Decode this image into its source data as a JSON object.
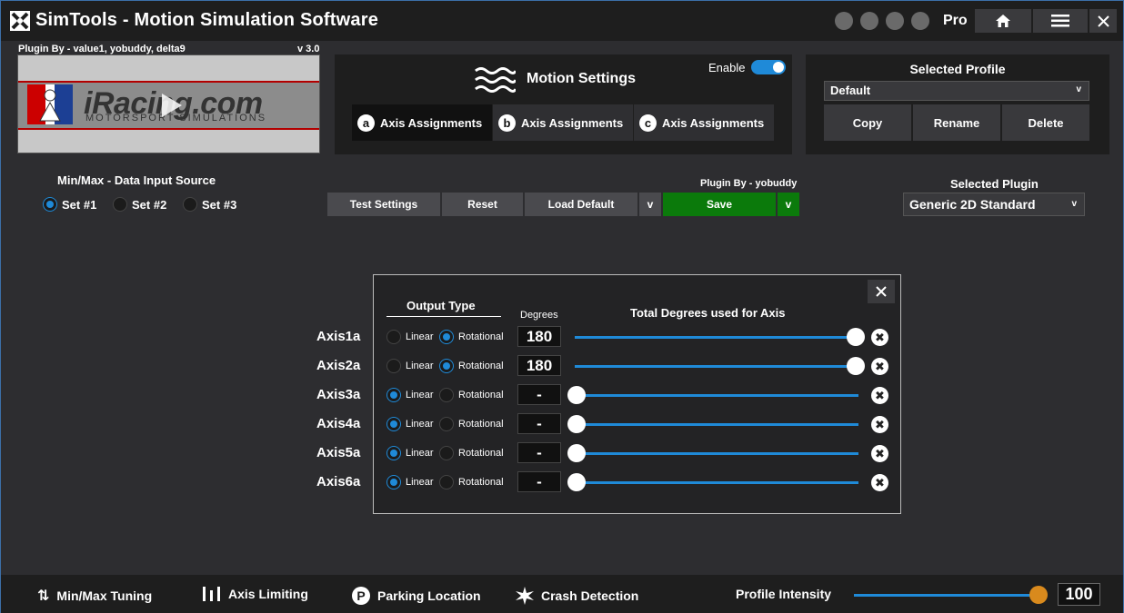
{
  "app": {
    "title": "SimTools - Motion Simulation Software",
    "edition": "Pro",
    "accent": "#1f8ad8"
  },
  "plugin_header": {
    "credit": "Plugin By - value1, yobuddy, delta9",
    "version": "v 3.0",
    "banner_brand": "iRacing.com",
    "banner_tagline": "MOTORSPORT SIMULATIONS"
  },
  "motion_settings": {
    "title": "Motion Settings",
    "enable_label": "Enable",
    "enabled": true,
    "tabs": [
      {
        "badge": "a",
        "label": "Axis Assignments"
      },
      {
        "badge": "b",
        "label": "Axis Assignments"
      },
      {
        "badge": "c",
        "label": "Axis Assignments"
      }
    ]
  },
  "profile": {
    "title": "Selected Profile",
    "selected": "Default",
    "buttons": {
      "copy": "Copy",
      "rename": "Rename",
      "delete": "Delete"
    }
  },
  "minmax": {
    "title": "Min/Max - Data Input Source",
    "sets": [
      {
        "label": "Set #1",
        "selected": true
      },
      {
        "label": "Set #2",
        "selected": false
      },
      {
        "label": "Set #3",
        "selected": false
      }
    ]
  },
  "actions": {
    "plugin_by": "Plugin By - yobuddy",
    "test": "Test Settings",
    "reset": "Reset",
    "load_default": "Load Default",
    "dropdown": "v",
    "save": "Save",
    "save_dropdown": "v",
    "save_color": "#0b7a0b"
  },
  "selected_plugin": {
    "title": "Selected Plugin",
    "value": "Generic 2D Standard"
  },
  "dialog": {
    "output_type": "Output Type",
    "degrees": "Degrees",
    "total": "Total Degrees used for Axis",
    "linear_label": "Linear",
    "rotational_label": "Rotational",
    "max_degrees": 180,
    "rows": [
      {
        "axis": "Axis1a",
        "linear": false,
        "rotational": true,
        "degrees": "180",
        "level": 1.0
      },
      {
        "axis": "Axis2a",
        "linear": false,
        "rotational": true,
        "degrees": "180",
        "level": 1.0
      },
      {
        "axis": "Axis3a",
        "linear": true,
        "rotational": false,
        "degrees": "-",
        "level": 0.0
      },
      {
        "axis": "Axis4a",
        "linear": true,
        "rotational": false,
        "degrees": "-",
        "level": 0.0
      },
      {
        "axis": "Axis5a",
        "linear": true,
        "rotational": false,
        "degrees": "-",
        "level": 0.0
      },
      {
        "axis": "Axis6a",
        "linear": true,
        "rotational": false,
        "degrees": "-",
        "level": 0.0
      }
    ]
  },
  "bottom_bar": {
    "items": [
      "Min/Max Tuning",
      "Axis Limiting",
      "Parking Location",
      "Crash Detection"
    ],
    "intensity_label": "Profile Intensity",
    "intensity_value": "100",
    "intensity_level": 1.0,
    "intensity_color": "#d98a1d"
  }
}
